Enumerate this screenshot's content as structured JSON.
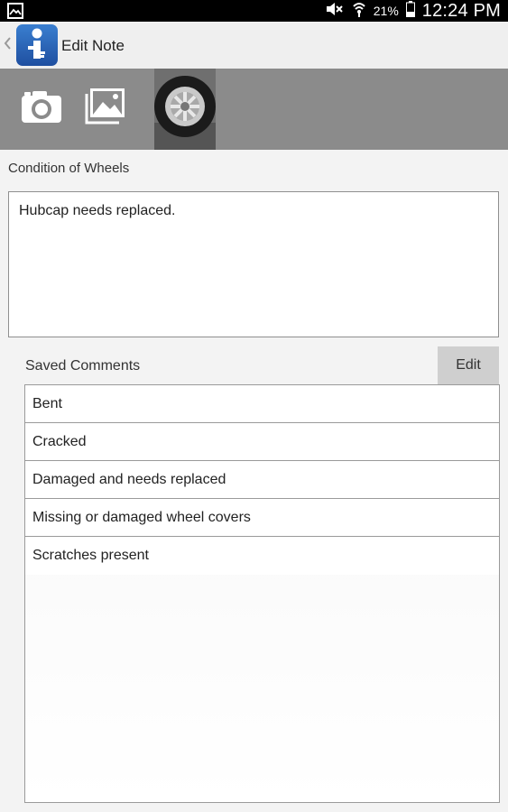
{
  "status_bar": {
    "battery_percent": "21%",
    "time": "12:24 PM",
    "icons": [
      "gallery-notification-icon",
      "mute-icon",
      "wifi-icon",
      "battery-icon"
    ]
  },
  "app_bar": {
    "title": "Edit Note",
    "icons": [
      "back-chevron-icon",
      "app-logo-icon"
    ]
  },
  "media_bar": {
    "icons": [
      "camera-icon",
      "gallery-icon"
    ],
    "thumbnail": "wheel-photo-thumbnail"
  },
  "note": {
    "label": "Condition of Wheels",
    "text": "Hubcap needs replaced."
  },
  "saved_comments": {
    "label": "Saved Comments",
    "edit_label": "Edit",
    "items": [
      "Bent",
      "Cracked",
      "Damaged and needs replaced",
      "Missing or damaged wheel covers",
      "Scratches present"
    ]
  },
  "colors": {
    "status_bar": "#000000",
    "app_bar": "#efefef",
    "media_bar": "#8b8b8b",
    "app_icon_blue": "#2d6cc0",
    "edit_button": "#cfcfcf"
  }
}
